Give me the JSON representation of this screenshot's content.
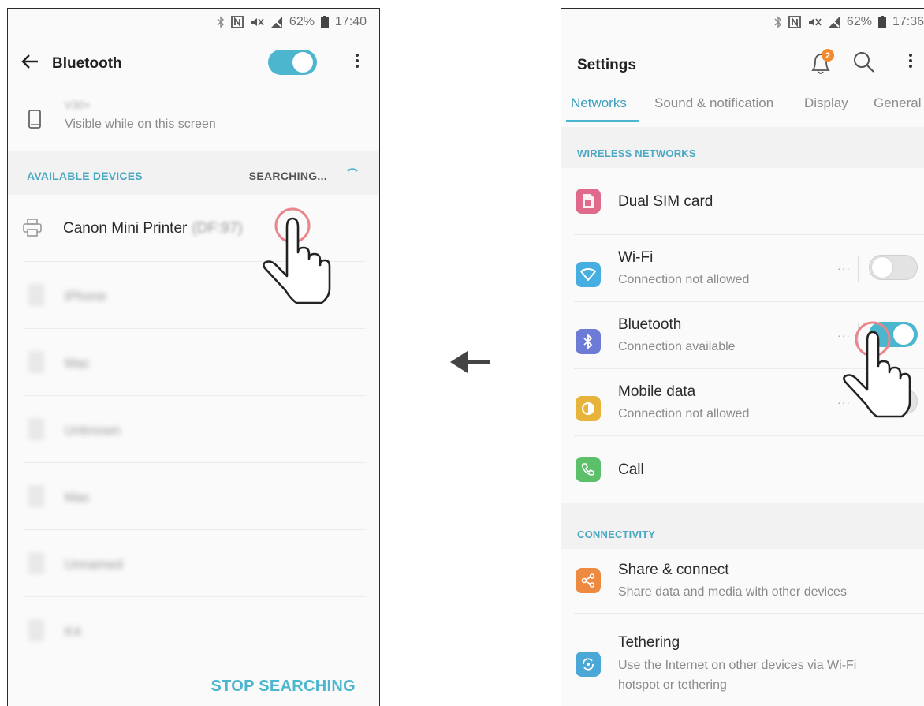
{
  "left_screen": {
    "status": {
      "battery": "62%",
      "time": "17:40"
    },
    "header": {
      "title": "Bluetooth"
    },
    "this_device": {
      "name": "V30+",
      "subtitle": "Visible while on this screen"
    },
    "section": {
      "label": "AVAILABLE DEVICES",
      "status": "SEARCHING..."
    },
    "devices": [
      {
        "name": "Canon Mini Printer",
        "id": "(DF:97)"
      },
      {
        "name": "iPhone"
      },
      {
        "name": "Mac"
      },
      {
        "name": "Unknown"
      },
      {
        "name": "Mac"
      },
      {
        "name": "Unnamed"
      },
      {
        "name": "K4"
      }
    ],
    "stop_button": "STOP SEARCHING"
  },
  "right_screen": {
    "status": {
      "battery": "62%",
      "time": "17:36"
    },
    "header": {
      "title": "Settings",
      "notification_count": "2"
    },
    "tabs": [
      "Networks",
      "Sound & notification",
      "Display",
      "General"
    ],
    "sections": {
      "wireless": "WIRELESS NETWORKS",
      "connectivity": "CONNECTIVITY"
    },
    "rows": {
      "dual_sim": {
        "title": "Dual SIM card"
      },
      "wifi": {
        "title": "Wi-Fi",
        "subtitle": "Connection not allowed"
      },
      "bluetooth": {
        "title": "Bluetooth",
        "subtitle": "Connection available"
      },
      "mobile_data": {
        "title": "Mobile data",
        "subtitle": "Connection not allowed"
      },
      "call": {
        "title": "Call"
      },
      "share": {
        "title": "Share & connect",
        "subtitle": "Share data and media with other devices"
      },
      "tethering": {
        "title": "Tethering",
        "subtitle": "Use the Internet on other devices via Wi-Fi hotspot or tethering"
      }
    },
    "more_dots": "···"
  },
  "colors": {
    "accent": "#4cb6cf",
    "tap_ring": "#e8868c",
    "icon_dual_sim": "#e06a8c",
    "icon_wifi": "#46aee0",
    "icon_bluetooth": "#6c7bd6",
    "icon_mobile_data": "#e8b33a",
    "icon_call": "#5cbf6a",
    "icon_share": "#ee8940",
    "icon_tethering": "#4ba8d6",
    "badge": "#f08a2c"
  }
}
